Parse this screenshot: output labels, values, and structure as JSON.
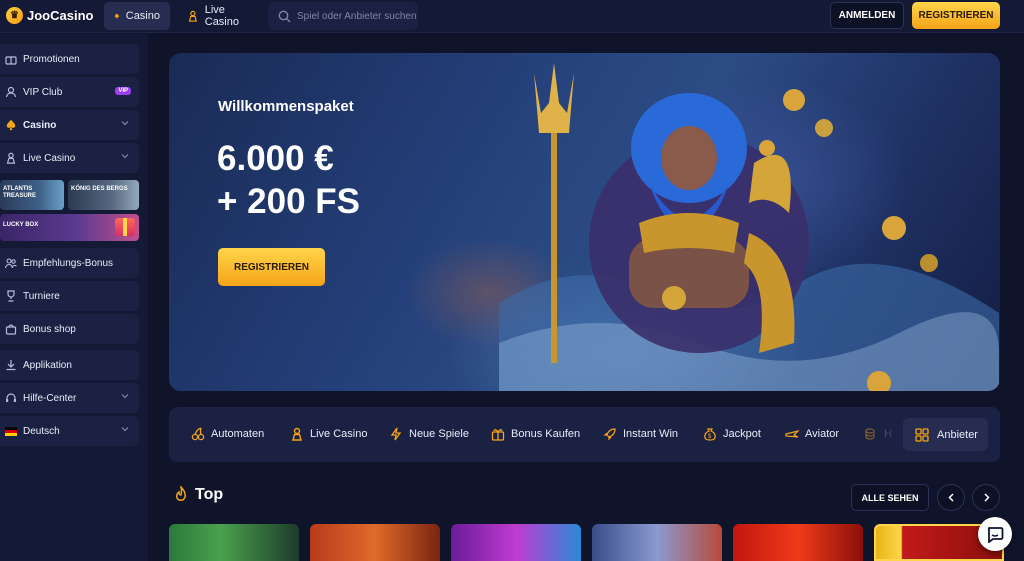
{
  "header": {
    "logo_text": "JooCasino",
    "tabs": [
      {
        "label": "Casino",
        "icon": "spade-icon",
        "active": true
      },
      {
        "label": "Live Casino",
        "icon": "dealer-icon",
        "active": false
      }
    ],
    "search_placeholder": "Spiel oder Anbieter suchen",
    "login_label": "ANMELDEN",
    "register_label": "REGISTRIEREN"
  },
  "sidebar": {
    "items": [
      {
        "label": "Promotionen",
        "icon": "gift-icon"
      },
      {
        "label": "VIP Club",
        "icon": "user-icon",
        "badge": "VIP"
      },
      {
        "label": "Casino",
        "icon": "spade-icon"
      },
      {
        "label": "Live Casino",
        "icon": "dealer-icon"
      },
      {
        "label": "Empfehlungs-Bonus",
        "icon": "users-icon"
      },
      {
        "label": "Turniere",
        "icon": "trophy-icon"
      },
      {
        "label": "Bonus shop",
        "icon": "shop-icon"
      },
      {
        "label": "Applikation",
        "icon": "download-icon"
      },
      {
        "label": "Hilfe-Center",
        "icon": "headset-icon"
      },
      {
        "label": "Deutsch",
        "icon": "german-flag-icon"
      }
    ],
    "promos": [
      {
        "label": "ATLANTIS TREASURE"
      },
      {
        "label": "KÖNIG DES BERGS"
      },
      {
        "label": "LUCKY BOX"
      }
    ]
  },
  "hero": {
    "title": "Willkommenspaket",
    "amount_line1": "6.000 €",
    "amount_line2": "+ 200 FS",
    "button_label": "REGISTRIEREN"
  },
  "categories": [
    {
      "label": "Automaten",
      "icon": "cherries-icon"
    },
    {
      "label": "Live Casino",
      "icon": "dealer-icon"
    },
    {
      "label": "Neue Spiele",
      "icon": "lightning-icon"
    },
    {
      "label": "Bonus Kaufen",
      "icon": "gift-icon"
    },
    {
      "label": "Instant Win",
      "icon": "rocket-icon"
    },
    {
      "label": "Jackpot",
      "icon": "moneybag-icon"
    },
    {
      "label": "Aviator",
      "icon": "plane-icon"
    },
    {
      "label": "H",
      "icon": "coins-icon"
    },
    {
      "label": "Anbieter",
      "icon": "grid-icon"
    }
  ],
  "top_section": {
    "title": "Top",
    "see_all_label": "ALLE SEHEN"
  },
  "colors": {
    "accent": "#f5a418",
    "background": "#10142b",
    "panel": "#1b2143",
    "vip_badge": "#9b3df0"
  }
}
